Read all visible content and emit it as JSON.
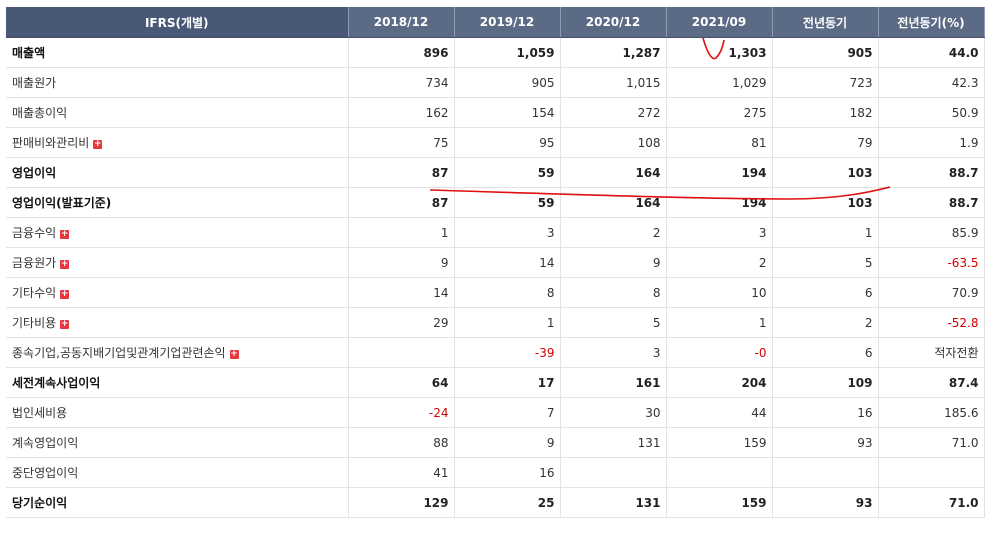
{
  "header": {
    "label": "IFRS(개별)",
    "columns": [
      "2018/12",
      "2019/12",
      "2020/12",
      "2021/09",
      "전년동기",
      "전년동기(%)"
    ]
  },
  "rows": [
    {
      "label": "매출액",
      "bold": true,
      "expand": false,
      "values": [
        "896",
        "1,059",
        "1,287",
        "1,303",
        "905",
        "44.0"
      ]
    },
    {
      "label": "매출원가",
      "bold": false,
      "expand": false,
      "values": [
        "734",
        "905",
        "1,015",
        "1,029",
        "723",
        "42.3"
      ]
    },
    {
      "label": "매출총이익",
      "bold": false,
      "expand": false,
      "values": [
        "162",
        "154",
        "272",
        "275",
        "182",
        "50.9"
      ]
    },
    {
      "label": "판매비와관리비",
      "bold": false,
      "expand": true,
      "values": [
        "75",
        "95",
        "108",
        "81",
        "79",
        "1.9"
      ]
    },
    {
      "label": "영업이익",
      "bold": true,
      "expand": false,
      "values": [
        "87",
        "59",
        "164",
        "194",
        "103",
        "88.7"
      ]
    },
    {
      "label": "영업이익(발표기준)",
      "bold": true,
      "expand": false,
      "values": [
        "87",
        "59",
        "164",
        "194",
        "103",
        "88.7"
      ]
    },
    {
      "label": "금융수익",
      "bold": false,
      "expand": true,
      "values": [
        "1",
        "3",
        "2",
        "3",
        "1",
        "85.9"
      ]
    },
    {
      "label": "금융원가",
      "bold": false,
      "expand": true,
      "values": [
        "9",
        "14",
        "9",
        "2",
        "5",
        "-63.5"
      ]
    },
    {
      "label": "기타수익",
      "bold": false,
      "expand": true,
      "values": [
        "14",
        "8",
        "8",
        "10",
        "6",
        "70.9"
      ]
    },
    {
      "label": "기타비용",
      "bold": false,
      "expand": true,
      "values": [
        "29",
        "1",
        "5",
        "1",
        "2",
        "-52.8"
      ]
    },
    {
      "label": "종속기업,공동지배기업및관계기업관련손익",
      "bold": false,
      "expand": true,
      "values": [
        "",
        "-39",
        "3",
        "-0",
        "6",
        "적자전환"
      ]
    },
    {
      "label": "세전계속사업이익",
      "bold": true,
      "expand": false,
      "values": [
        "64",
        "17",
        "161",
        "204",
        "109",
        "87.4"
      ]
    },
    {
      "label": "법인세비용",
      "bold": false,
      "expand": false,
      "values": [
        "-24",
        "7",
        "30",
        "44",
        "16",
        "185.6"
      ]
    },
    {
      "label": "계속영업이익",
      "bold": false,
      "expand": false,
      "values": [
        "88",
        "9",
        "131",
        "159",
        "93",
        "71.0"
      ]
    },
    {
      "label": "중단영업이익",
      "bold": false,
      "expand": false,
      "values": [
        "41",
        "16",
        "",
        "",
        "",
        ""
      ]
    },
    {
      "label": "당기순이익",
      "bold": true,
      "expand": false,
      "values": [
        "129",
        "25",
        "131",
        "159",
        "93",
        "71.0"
      ]
    }
  ],
  "expand_icon": "plus-icon",
  "colors": {
    "header_bg": "#5b6a85",
    "negative": "#d40000",
    "annotation": "#e01010"
  }
}
